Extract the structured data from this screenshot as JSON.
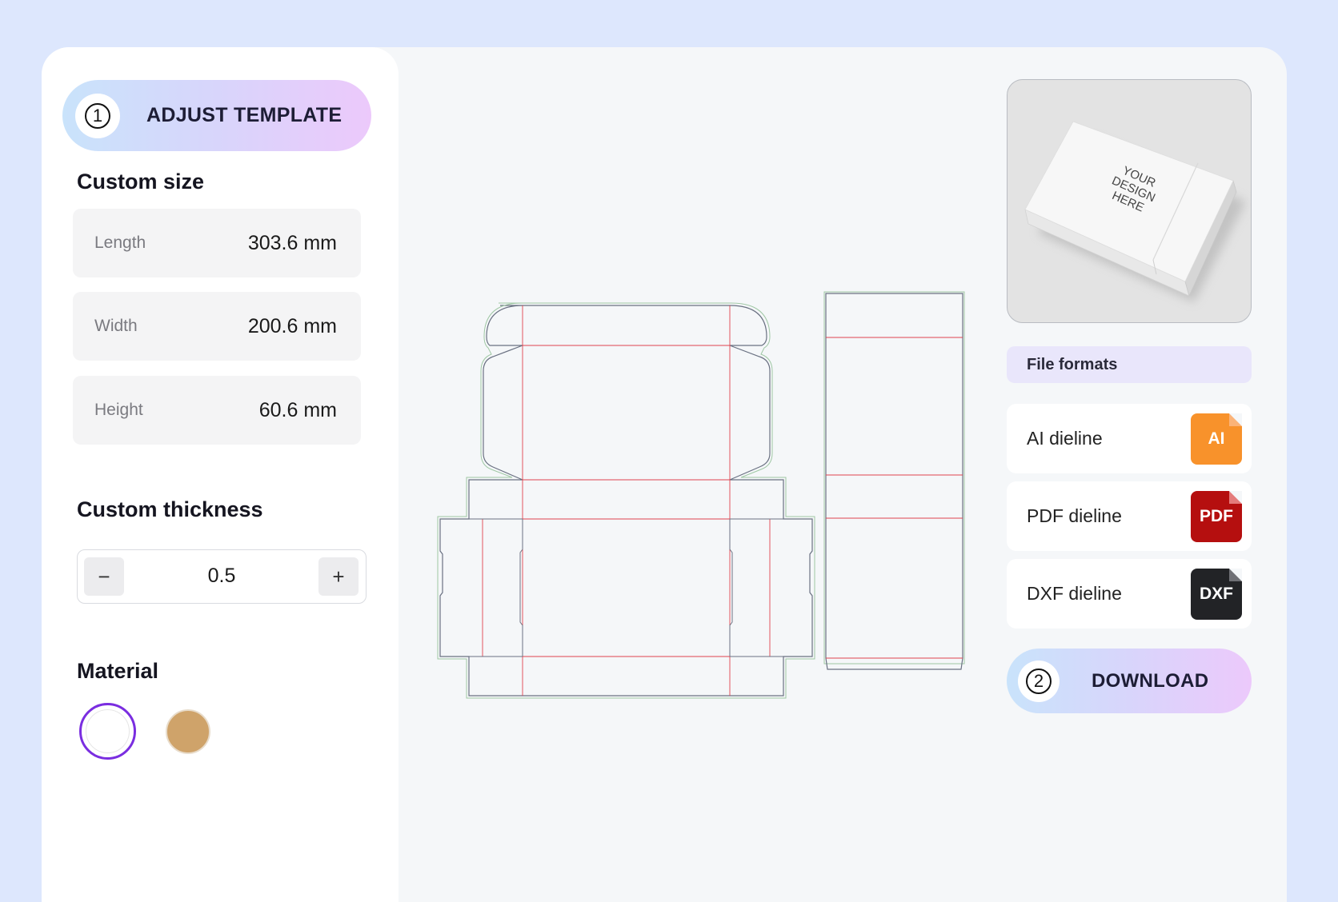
{
  "step1": {
    "number": "1",
    "label": "ADJUST TEMPLATE"
  },
  "custom_size": {
    "title": "Custom size",
    "rows": [
      {
        "label": "Length",
        "value": "303.6 mm"
      },
      {
        "label": "Width",
        "value": "200.6 mm"
      },
      {
        "label": "Height",
        "value": "60.6 mm"
      }
    ]
  },
  "thickness": {
    "title": "Custom thickness",
    "minus": "−",
    "value": "0.5",
    "plus": "+"
  },
  "material": {
    "title": "Material",
    "options": [
      "white",
      "kraft"
    ],
    "selected": "white"
  },
  "preview": {
    "caption_line1": "YOUR",
    "caption_line2": "DESIGN",
    "caption_line3": "HERE"
  },
  "file_formats": {
    "title": "File formats",
    "items": [
      {
        "label": "AI dieline",
        "icon": "AI"
      },
      {
        "label": "PDF dieline",
        "icon": "PDF"
      },
      {
        "label": "DXF dieline",
        "icon": "DXF"
      }
    ]
  },
  "step2": {
    "number": "2",
    "label": "DOWNLOAD"
  },
  "colors": {
    "accent": "#7a2de0",
    "kraft": "#cfa36a",
    "cut_line": "#9fc7a4",
    "fold_line": "#e0434e",
    "dieline_outline": "#6a7182"
  }
}
